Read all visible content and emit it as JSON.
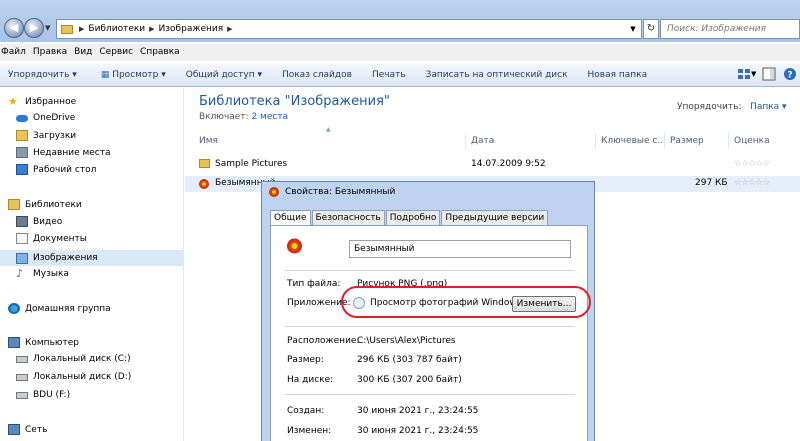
{
  "address": {
    "breadcrumbs": [
      "Библиотеки",
      "Изображения"
    ],
    "search_placeholder": "Поиск: Изображения"
  },
  "menu": [
    "Файл",
    "Правка",
    "Вид",
    "Сервис",
    "Справка"
  ],
  "toolbar": [
    "Упорядочить ▾",
    "Просмотр ▾",
    "Общий доступ ▾",
    "Показ слайдов",
    "Печать",
    "Записать на оптический диск",
    "Новая папка"
  ],
  "nav": {
    "favorites": "Избранное",
    "onedrive": "OneDrive",
    "downloads": "Загрузки",
    "recent": "Недавние места",
    "desktop": "Рабочий стол",
    "libraries": "Библиотеки",
    "video": "Видео",
    "documents": "Документы",
    "images": "Изображения",
    "music": "Музыка",
    "homegroup": "Домашняя группа",
    "computer": "Компьютер",
    "disk_c": "Локальный диск (C:)",
    "disk_d": "Локальный диск (D:)",
    "bdu": "BDU (F:)",
    "network": "Сеть"
  },
  "content": {
    "title": "Библиотека \"Изображения\"",
    "includes_label": "Включает:",
    "includes_link": "2 места",
    "arrange_label": "Упорядочить:",
    "arrange_value": "Папка ▾",
    "columns": [
      "Имя",
      "Дата",
      "Ключевые с...",
      "Размер",
      "Оценка"
    ],
    "rows": [
      {
        "name": "Sample Pictures",
        "date": "14.07.2009 9:52",
        "size": "",
        "rating": "☆☆☆☆☆"
      },
      {
        "name": "Безымянный",
        "date": "",
        "size": "297 КБ",
        "rating": "☆☆☆☆☆"
      }
    ]
  },
  "dialog": {
    "title": "Свойства: Безымянный",
    "tabs": [
      "Общие",
      "Безопасность",
      "Подробно",
      "Предыдущие версии"
    ],
    "filename": "Безымянный",
    "type_label": "Тип файла:",
    "type_value": "Рисунок PNG (.png)",
    "app_label": "Приложение:",
    "app_value": "Просмотр фотографий Windows",
    "change_button": "Изменить...",
    "location_label": "Расположение:",
    "location_value": "C:\\Users\\Alex\\Pictures",
    "size_label": "Размер:",
    "size_value": "296 КБ (303 787 байт)",
    "disk_label": "На диске:",
    "disk_value": "300 КБ (307 200 байт)",
    "created_label": "Создан:",
    "created_value": "30 июня 2021 г., 23:24:55",
    "modified_label": "Изменен:",
    "modified_value": "30 июня 2021 г., 23:24:55"
  }
}
